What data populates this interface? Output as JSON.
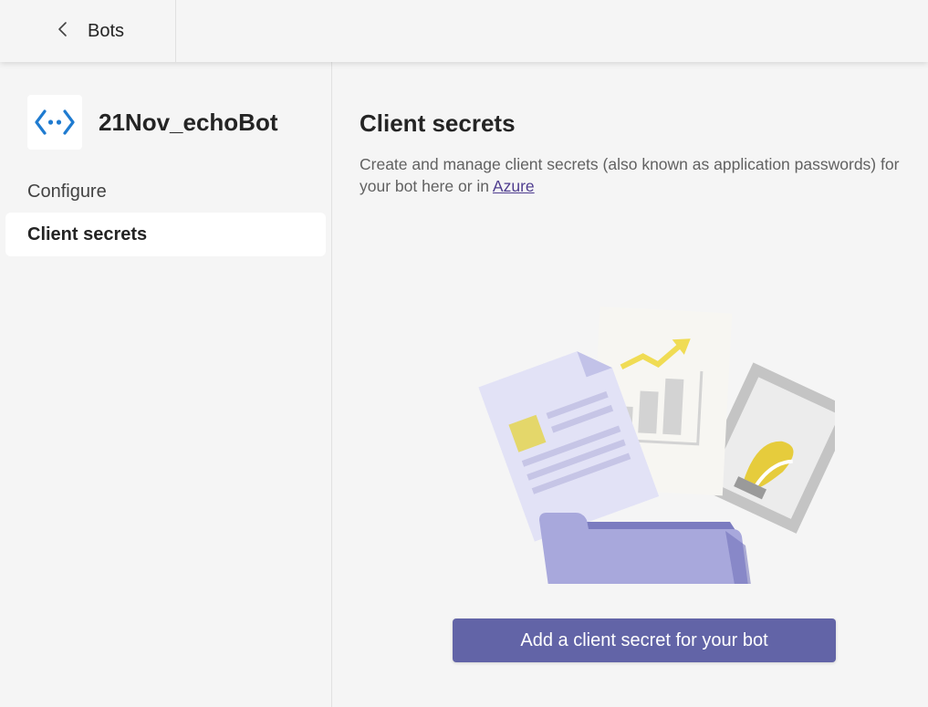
{
  "topbar": {
    "back_label": "Bots",
    "back_icon": "chevron-left-icon"
  },
  "sidebar": {
    "app_icon": "bot-code-icon",
    "app_name": "21Nov_echoBot",
    "items": [
      {
        "label": "Configure",
        "selected": false
      },
      {
        "label": "Client secrets",
        "selected": true
      }
    ]
  },
  "main": {
    "title": "Client secrets",
    "description_prefix": "Create and manage client secrets (also known as application passwords) for your bot here or in ",
    "description_link": "Azure",
    "illustration": "documents-folder-illustration",
    "primary_button": "Add a client secret for your bot"
  },
  "colors": {
    "accent": "#6264a7",
    "link": "#4f3d8f",
    "icon_blue": "#1f7bd0",
    "background": "#f5f5f5",
    "selected_bg": "#ffffff"
  }
}
